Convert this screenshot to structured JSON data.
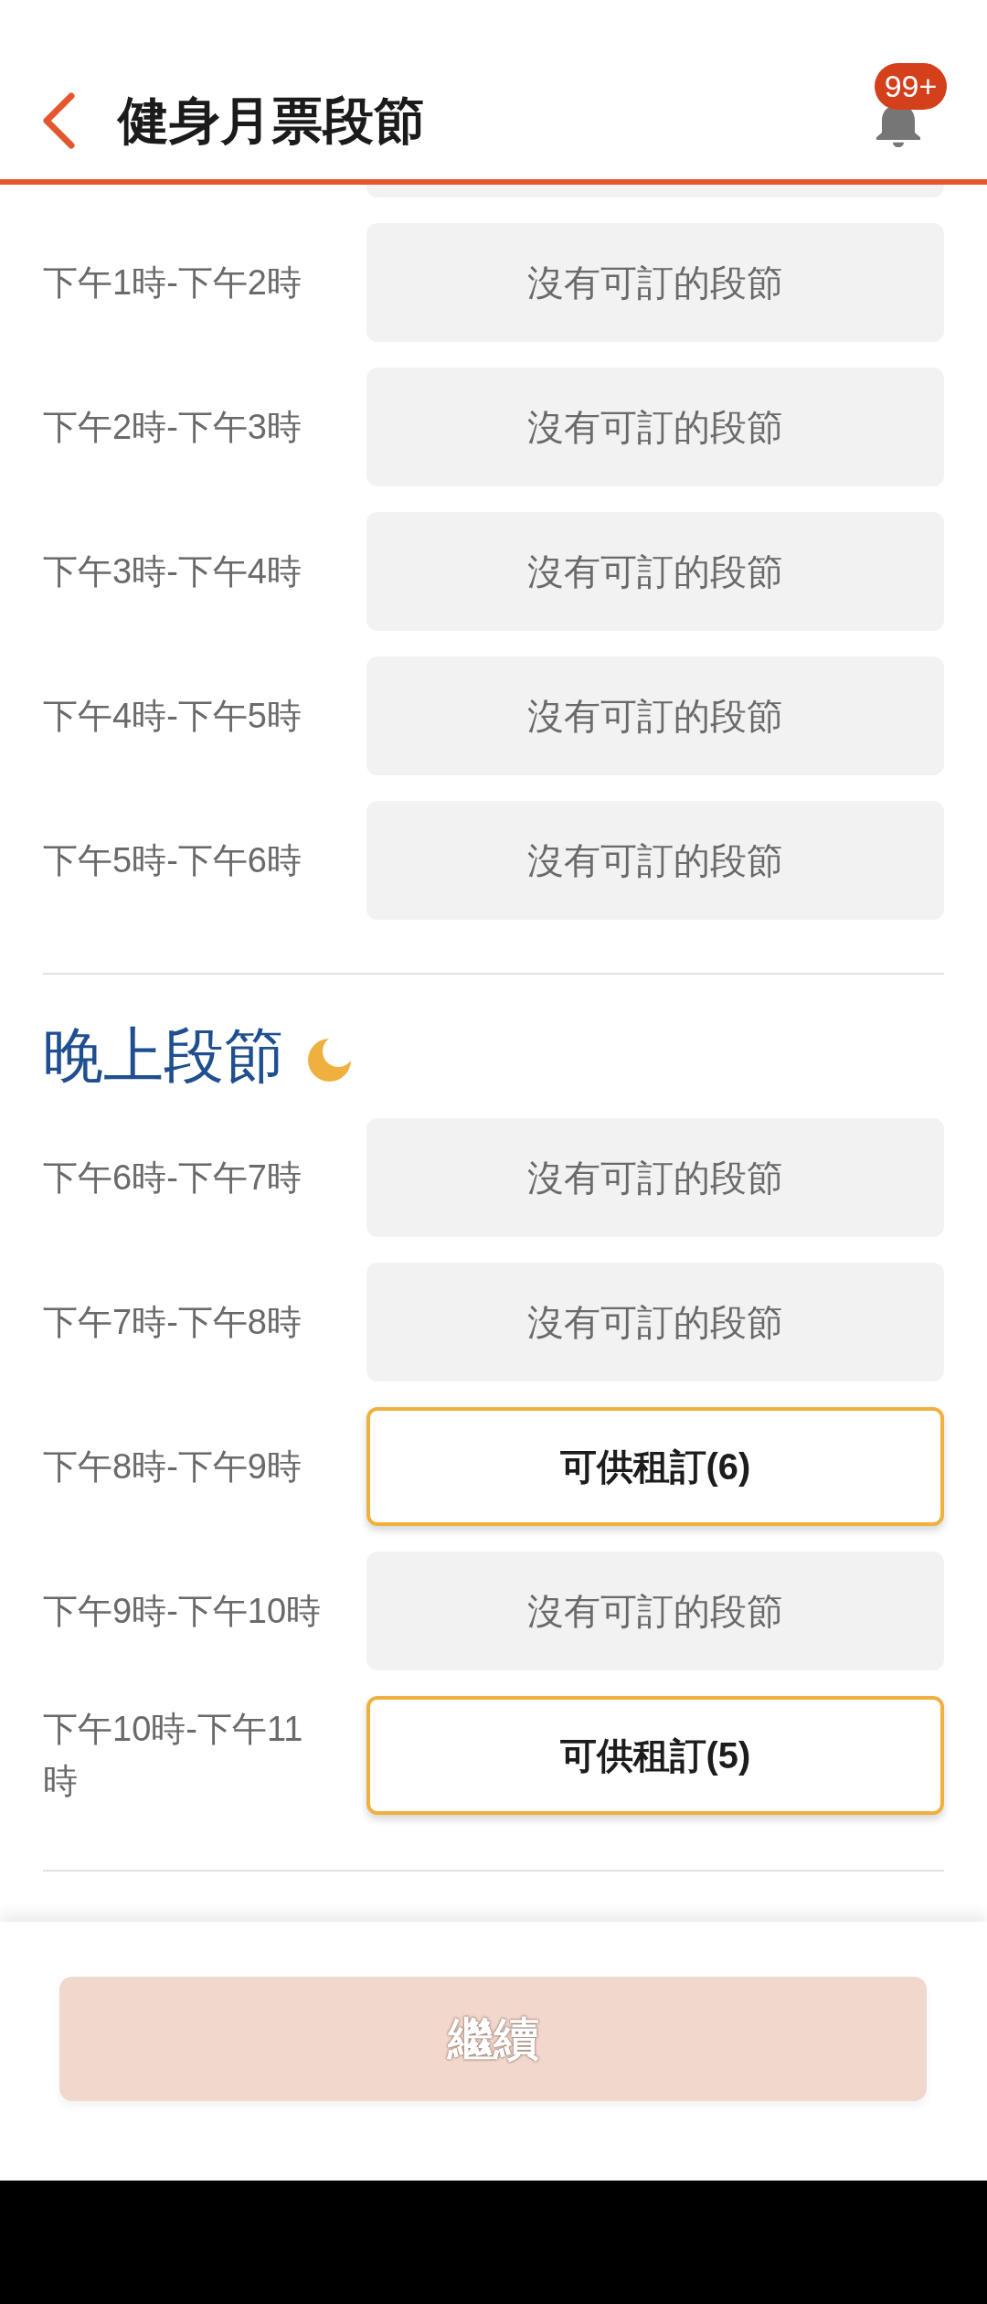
{
  "header": {
    "title": "健身月票段節",
    "notification_badge": "99+"
  },
  "sections": [
    {
      "partial_slot": {
        "available": false
      },
      "slots": [
        {
          "time": "下午1時-下午2時",
          "status": "沒有可訂的段節",
          "available": false
        },
        {
          "time": "下午2時-下午3時",
          "status": "沒有可訂的段節",
          "available": false
        },
        {
          "time": "下午3時-下午4時",
          "status": "沒有可訂的段節",
          "available": false
        },
        {
          "time": "下午4時-下午5時",
          "status": "沒有可訂的段節",
          "available": false
        },
        {
          "time": "下午5時-下午6時",
          "status": "沒有可訂的段節",
          "available": false
        }
      ]
    },
    {
      "heading": "晚上段節",
      "slots": [
        {
          "time": "下午6時-下午7時",
          "status": "沒有可訂的段節",
          "available": false
        },
        {
          "time": "下午7時-下午8時",
          "status": "沒有可訂的段節",
          "available": false
        },
        {
          "time": "下午8時-下午9時",
          "status": "可供租訂(6)",
          "available": true
        },
        {
          "time": "下午9時-下午10時",
          "status": "沒有可訂的段節",
          "available": false
        },
        {
          "time": "下午10時-下午11時",
          "status": "可供租訂(5)",
          "available": true
        }
      ]
    }
  ],
  "continue_button": {
    "label": "繼續",
    "disabled": true
  }
}
